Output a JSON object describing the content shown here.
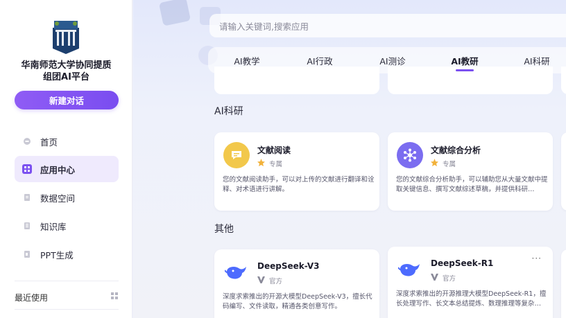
{
  "sidebar": {
    "org_title_line1": "华南师范大学协同提质",
    "org_title_line2": "组团AI平台",
    "new_chat_label": "新建对话",
    "nav": [
      {
        "label": "首页",
        "icon": "home-icon"
      },
      {
        "label": "应用中心",
        "icon": "apps-icon"
      },
      {
        "label": "数据空间",
        "icon": "data-space-icon"
      },
      {
        "label": "知识库",
        "icon": "knowledge-base-icon"
      },
      {
        "label": "PPT生成",
        "icon": "ppt-icon"
      }
    ],
    "recent_label": "最近使用"
  },
  "search": {
    "placeholder": "请输入关键词,搜索应用"
  },
  "tabs": [
    {
      "label": "AI教学"
    },
    {
      "label": "AI行政"
    },
    {
      "label": "AI测诊"
    },
    {
      "label": "AI教研",
      "active": true
    },
    {
      "label": "AI科研"
    }
  ],
  "sections": {
    "research_title": "AI科研",
    "other_title": "其他"
  },
  "research_cards": [
    {
      "name": "文献阅读",
      "tag": "专属",
      "description": "您的文献阅读助手，可以对上传的文献进行翻译和诠释、对术语进行讲解。"
    },
    {
      "name": "文献综合分析",
      "tag": "专属",
      "description": "您的文献综合分析助手，可以辅助您从大量文献中提取关键信息、撰写文献综述草稿，并提供科研…"
    }
  ],
  "other_cards": [
    {
      "name": "DeepSeek-V3",
      "tag": "官方",
      "description": "深度求索推出的开源大模型DeepSeek-V3，擅长代码编写、文件读取，精通各类创意写作。"
    },
    {
      "name": "DeepSeek-R1",
      "tag": "官方",
      "description": "深度求索推出的开源推理大模型DeepSeek-R1，擅长处理写作、长文本总结提炼、数理推理等复杂…"
    }
  ],
  "colors": {
    "accent": "#7b50f0",
    "card_yellow": "#f2c84b",
    "card_purple": "#7b6df0",
    "deepseek_blue": "#4d6bfe"
  }
}
